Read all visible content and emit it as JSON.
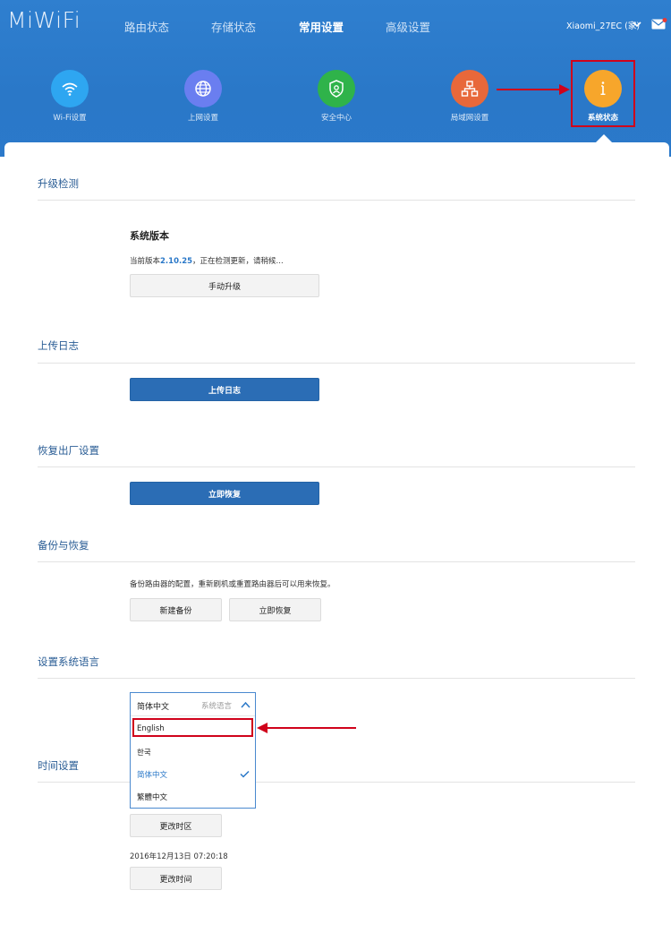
{
  "header": {
    "logo": "MiWiFi",
    "nav": [
      "路由状态",
      "存储状态",
      "常用设置",
      "高级设置"
    ],
    "active_nav": "常用设置",
    "device_name": "Xiaomi_27EC (家)",
    "tiles": [
      {
        "label": "Wi-Fi设置",
        "icon": "wifi-icon",
        "color": "#2ea6f1"
      },
      {
        "label": "上网设置",
        "icon": "globe-icon",
        "color": "#6a7ef0"
      },
      {
        "label": "安全中心",
        "icon": "shield-icon",
        "color": "#2fb34a"
      },
      {
        "label": "局域网设置",
        "icon": "lan-icon",
        "color": "#e8683a"
      },
      {
        "label": "系统状态",
        "icon": "info-icon",
        "color": "#f7a62b"
      }
    ],
    "annotation_color": "#d0021b"
  },
  "sections": {
    "upgrade": {
      "title": "升级检测",
      "version_label": "系统版本",
      "status_prefix": "当前版本",
      "version": "2.10.25",
      "status_suffix": "，正在检测更新，请稍候...",
      "button": "手动升级"
    },
    "log": {
      "title": "上传日志",
      "button": "上传日志"
    },
    "reset": {
      "title": "恢复出厂设置",
      "button": "立即恢复"
    },
    "backup": {
      "title": "备份与恢复",
      "desc": "备份路由器的配置，重新刷机或重置路由器后可以用来恢复。",
      "backup_button": "新建备份",
      "restore_button": "立即恢复"
    },
    "language": {
      "title": "设置系统语言",
      "selected": "简体中文",
      "hint": "系统语言",
      "options": [
        "English",
        "한국",
        "简体中文",
        "繁體中文"
      ],
      "current_option": "简体中文"
    },
    "time": {
      "title": "时间设置",
      "timezone_button": "更改时区",
      "datetime": "2016年12月13日 07:20:18",
      "time_button": "更改时间"
    }
  }
}
